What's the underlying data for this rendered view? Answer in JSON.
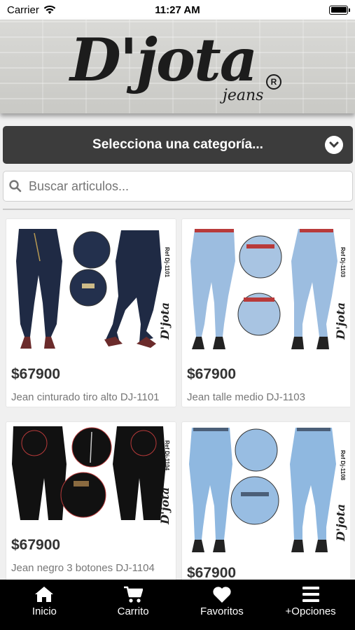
{
  "status_bar": {
    "carrier": "Carrier",
    "time": "11:27 AM"
  },
  "brand": {
    "name": "D'jota",
    "sub": "jeans",
    "reg": "R"
  },
  "category": {
    "label": "Selecciona una categoría..."
  },
  "search": {
    "placeholder": "Buscar articulos..."
  },
  "products": [
    {
      "price": "$67900",
      "name": "Jean cinturado tiro alto DJ-1101",
      "ref": "Ref Dj-1101",
      "logo": "D'jota",
      "wash": "dark"
    },
    {
      "price": "$67900",
      "name": "Jean talle medio DJ-1103",
      "ref": "Ref Dj-1103",
      "logo": "D'jota",
      "wash": "light"
    },
    {
      "price": "$67900",
      "name": "Jean negro 3 botones DJ-1104",
      "ref": "Ref Dj-1104",
      "logo": "D'jota",
      "wash": "black"
    },
    {
      "price": "$67900",
      "name": "",
      "ref": "Ref Dj-1108",
      "logo": "D'jota",
      "wash": "light"
    }
  ],
  "tabs": [
    {
      "label": "Inicio",
      "icon": "home-icon"
    },
    {
      "label": "Carrito",
      "icon": "cart-icon"
    },
    {
      "label": "Favoritos",
      "icon": "heart-icon"
    },
    {
      "label": "+Opciones",
      "icon": "menu-icon"
    }
  ],
  "colors": {
    "accent": "#3c3c3c",
    "tab_bar": "#000000"
  }
}
